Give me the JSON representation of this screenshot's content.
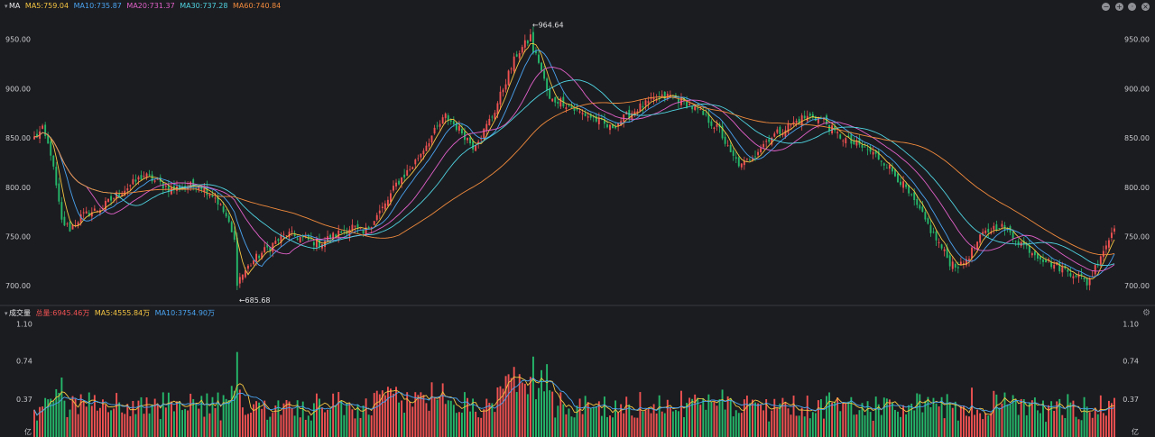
{
  "price_header": {
    "title": "MA",
    "ma5": "MA5:759.04",
    "ma10": "MA10:735.87",
    "ma20": "MA20:731.37",
    "ma30": "MA30:737.28",
    "ma60": "MA60:740.84"
  },
  "volume_header": {
    "title": "成交量",
    "total": "总量:6945.46万",
    "ma5": "MA5:4555.84万",
    "ma10": "MA10:3754.90万"
  },
  "colors": {
    "up": "#f05252",
    "down": "#25b86b",
    "ma5": "#f5c542",
    "ma10": "#4aa3f0",
    "ma20": "#e060c8",
    "ma30": "#4fd3e0",
    "ma60": "#f08a3c"
  },
  "chart_data": [
    {
      "type": "candlestick",
      "y_ticks": [
        "950.00",
        "900.00",
        "850.00",
        "800.00",
        "750.00",
        "700.00"
      ],
      "y_tick_values": [
        950,
        900,
        850,
        800,
        750,
        700
      ],
      "ylim": [
        681,
        978
      ],
      "max_label": "964.64",
      "min_label": "685.68",
      "max_value": 964.64,
      "min_value": 685.68,
      "anchors": [
        [
          0,
          850
        ],
        [
          3,
          858
        ],
        [
          6,
          835
        ],
        [
          10,
          765
        ],
        [
          13,
          758
        ],
        [
          17,
          770
        ],
        [
          25,
          780
        ],
        [
          30,
          792
        ],
        [
          40,
          812
        ],
        [
          50,
          798
        ],
        [
          60,
          803
        ],
        [
          66,
          790
        ],
        [
          70,
          770
        ],
        [
          73,
          745
        ],
        [
          74,
          705
        ],
        [
          76,
          712
        ],
        [
          80,
          726
        ],
        [
          85,
          738
        ],
        [
          92,
          753
        ],
        [
          98,
          748
        ],
        [
          104,
          743
        ],
        [
          110,
          752
        ],
        [
          116,
          760
        ],
        [
          120,
          752
        ],
        [
          124,
          768
        ],
        [
          128,
          782
        ],
        [
          132,
          803
        ],
        [
          138,
          822
        ],
        [
          144,
          848
        ],
        [
          150,
          872
        ],
        [
          156,
          856
        ],
        [
          160,
          842
        ],
        [
          164,
          857
        ],
        [
          168,
          878
        ],
        [
          172,
          908
        ],
        [
          176,
          935
        ],
        [
          180,
          948
        ],
        [
          184,
          928
        ],
        [
          188,
          888
        ],
        [
          192,
          888
        ],
        [
          198,
          877
        ],
        [
          204,
          870
        ],
        [
          210,
          860
        ],
        [
          214,
          868
        ],
        [
          220,
          880
        ],
        [
          226,
          888
        ],
        [
          232,
          893
        ],
        [
          238,
          885
        ],
        [
          244,
          873
        ],
        [
          250,
          858
        ],
        [
          254,
          833
        ],
        [
          258,
          821
        ],
        [
          262,
          832
        ],
        [
          268,
          850
        ],
        [
          274,
          860
        ],
        [
          280,
          870
        ],
        [
          284,
          872
        ],
        [
          288,
          868
        ],
        [
          292,
          855
        ],
        [
          298,
          845
        ],
        [
          304,
          838
        ],
        [
          310,
          826
        ],
        [
          316,
          806
        ],
        [
          322,
          780
        ],
        [
          328,
          752
        ],
        [
          334,
          724
        ],
        [
          338,
          720
        ],
        [
          342,
          735
        ],
        [
          346,
          752
        ],
        [
          352,
          762
        ],
        [
          358,
          748
        ],
        [
          364,
          735
        ],
        [
          370,
          724
        ],
        [
          376,
          716
        ],
        [
          380,
          712
        ],
        [
          384,
          703
        ],
        [
          386,
          712
        ],
        [
          389,
          732
        ],
        [
          392,
          747
        ],
        [
          394,
          762
        ]
      ]
    },
    {
      "type": "bar",
      "y_ticks": [
        "1.10",
        "0.74",
        "0.37"
      ],
      "y_tick_values": [
        1.1,
        0.74,
        0.37
      ],
      "unit": "亿",
      "ylim": [
        0,
        1.15
      ]
    }
  ]
}
